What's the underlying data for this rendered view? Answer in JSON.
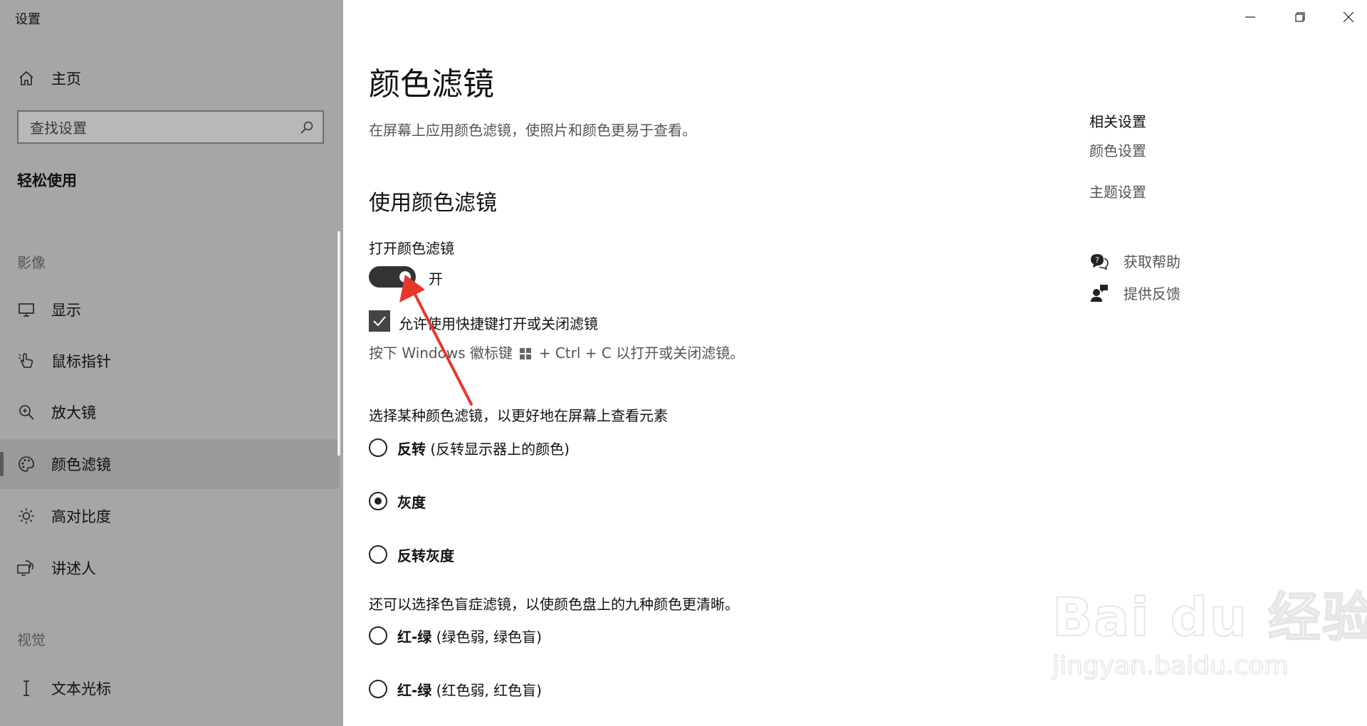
{
  "window": {
    "title": "设置"
  },
  "sidebar": {
    "home": "主页",
    "search_placeholder": "查找设置",
    "category": "轻松使用",
    "section_vision": "影像",
    "items": [
      {
        "label": "显示",
        "icon": "monitor-icon"
      },
      {
        "label": "鼠标指针",
        "icon": "mouse-pointer-icon"
      },
      {
        "label": "放大镜",
        "icon": "magnifier-icon"
      },
      {
        "label": "颜色滤镜",
        "icon": "palette-icon",
        "selected": true
      },
      {
        "label": "高对比度",
        "icon": "sun-icon"
      },
      {
        "label": "讲述人",
        "icon": "narrator-icon"
      }
    ],
    "section_visual": "视觉",
    "items2": [
      {
        "label": "文本光标",
        "icon": "text-cursor-icon"
      }
    ]
  },
  "main": {
    "title": "颜色滤镜",
    "description": "在屏幕上应用颜色滤镜，使照片和颜色更易于查看。",
    "subtitle": "使用颜色滤镜",
    "toggle_label": "打开颜色滤镜",
    "toggle_state": "开",
    "toggle_on": true,
    "shortcut_checkbox_label": "允许使用快捷键打开或关闭滤镜",
    "shortcut_checked": true,
    "shortcut_hint_before": "按下 Windows 徽标键",
    "shortcut_hint_after": "+ Ctrl + C 以打开或关闭滤镜。",
    "choose_label": "选择某种颜色滤镜，以更好地在屏幕上查看元素",
    "filters": [
      {
        "bold": "反转",
        "extra": " (反转显示器上的颜色)",
        "checked": false
      },
      {
        "bold": "灰度",
        "extra": "",
        "checked": true
      },
      {
        "bold": "反转灰度",
        "extra": "",
        "checked": false
      }
    ],
    "colorblind_label": "还可以选择色盲症滤镜，以使颜色盘上的九种颜色更清晰。",
    "colorblind_filters": [
      {
        "bold": "红-绿",
        "extra": " (绿色弱, 绿色盲)",
        "checked": false
      },
      {
        "bold": "红-绿",
        "extra": " (红色弱, 红色盲)",
        "checked": false
      }
    ]
  },
  "related": {
    "title": "相关设置",
    "links": [
      "颜色设置",
      "主题设置"
    ],
    "help": "获取帮助",
    "feedback": "提供反馈"
  },
  "watermark": {
    "main": "Bai du 经验",
    "sub": "jingyan.baidu.com"
  },
  "colors": {
    "sidebar": "#a6a6a6",
    "toggle": "#333333",
    "arrow": "#e8362c"
  }
}
